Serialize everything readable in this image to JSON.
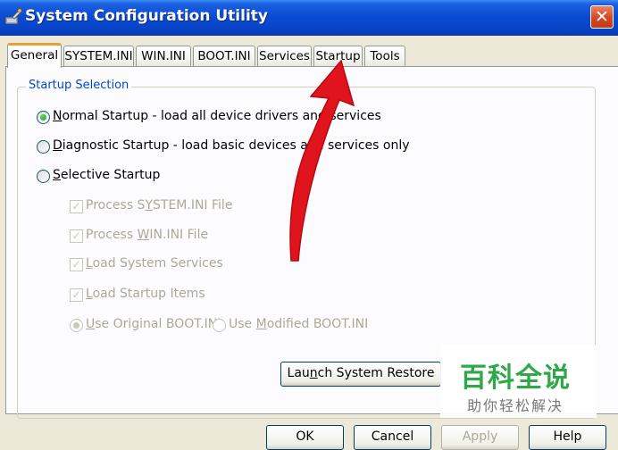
{
  "window": {
    "title": "System Configuration Utility",
    "icon": "system-config-icon",
    "close_glyph": "✕"
  },
  "tabs": [
    {
      "label": "General",
      "active": true
    },
    {
      "label": "SYSTEM.INI",
      "active": false
    },
    {
      "label": "WIN.INI",
      "active": false
    },
    {
      "label": "BOOT.INI",
      "active": false
    },
    {
      "label": "Services",
      "active": false
    },
    {
      "label": "Startup",
      "active": false
    },
    {
      "label": "Tools",
      "active": false
    }
  ],
  "startup_selection": {
    "legend": "Startup Selection",
    "normal": {
      "mnemonic": "N",
      "rest": "ormal Startup - load all device drivers and services",
      "checked": true
    },
    "diagnostic": {
      "mnemonic": "D",
      "rest": "iagnostic Startup - load basic devices and services only",
      "checked": false
    },
    "selective": {
      "mnemonic": "S",
      "rest": "elective Startup",
      "checked": false
    },
    "options": [
      {
        "pre": "Process S",
        "mnemonic": "Y",
        "post": "STEM.INI File",
        "checked": true
      },
      {
        "pre": "Process ",
        "mnemonic": "W",
        "post": "IN.INI File",
        "checked": true
      },
      {
        "pre": "",
        "mnemonic": "L",
        "post": "oad System Services",
        "checked": true
      },
      {
        "pre": "",
        "mnemonic": "L",
        "post": "oad Startup Items",
        "checked": true
      }
    ],
    "boot_original": {
      "pre": "",
      "mnemonic": "U",
      "post": "se Original BOOT.INI",
      "checked": true
    },
    "boot_modified": {
      "pre": "Use ",
      "mnemonic": "M",
      "post": "odified BOOT.INI",
      "checked": false
    }
  },
  "launch_restore": {
    "pre": "Lau",
    "mnemonic": "n",
    "post": "ch System Restore"
  },
  "buttons": {
    "ok": "OK",
    "cancel": "Cancel",
    "apply": "Apply",
    "help": "Help"
  },
  "watermark": {
    "main": "百科全说",
    "sub": "助你轻松解决"
  },
  "colors": {
    "title_bar": "#0a4ad2",
    "legend_text": "#0046d5",
    "arrow": "#e0141c",
    "watermark_green": "#2fa84a"
  }
}
